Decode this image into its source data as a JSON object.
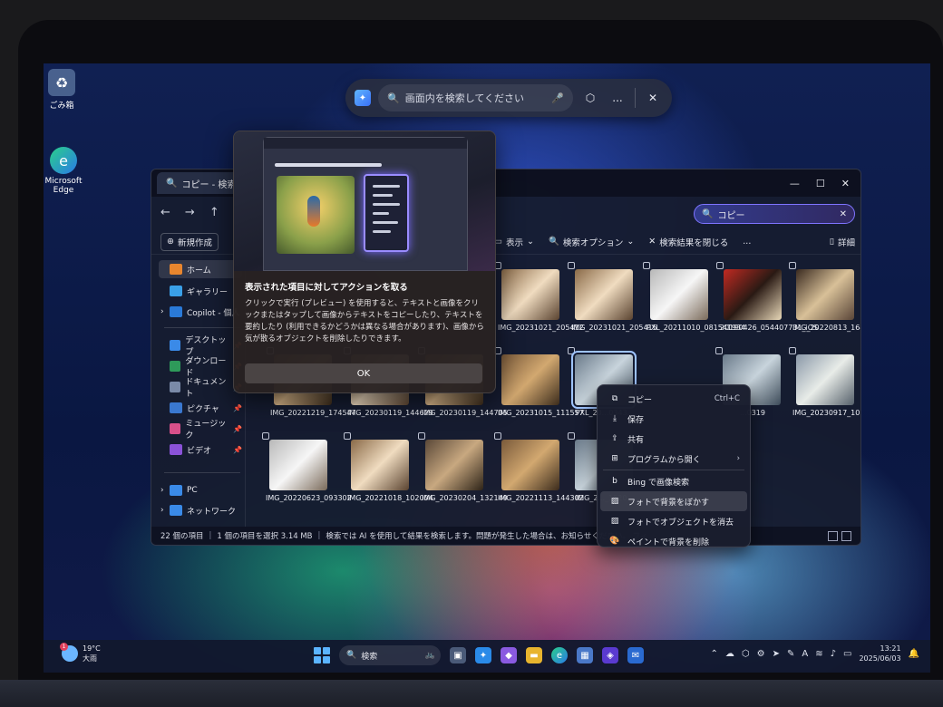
{
  "desktop": {
    "icons": [
      {
        "label": "ごみ箱",
        "icon": "recycle-bin-icon"
      },
      {
        "label": "Microsoft Edge",
        "icon": "edge-icon"
      }
    ]
  },
  "click_to_do": {
    "search_placeholder": "画面内を検索してください",
    "more_label": "...",
    "close_label": "✕"
  },
  "popup": {
    "title": "表示された項目に対してアクションを取る",
    "body": "クリックで実行 (プレビュー) を使用すると、テキストと画像をクリックまたはタップして画像からテキストをコピーしたり、テキストを要約したり (利用できるかどうかは異なる場合があります)、画像から気が散るオブジェクトを削除したりできます。",
    "ok_label": "OK"
  },
  "explorer": {
    "tab_title": "コピー - 検索場所",
    "search_value": "コピー",
    "toolbar": {
      "new_label": "新規作成",
      "view_label": "表示",
      "search_options_label": "検索オプション",
      "close_results_label": "検索結果を閉じる",
      "more_label": "...",
      "details_label": "詳細"
    },
    "sidebar": {
      "top": [
        {
          "label": "ホーム",
          "icon": "home-icon",
          "color": "#e8862e"
        },
        {
          "label": "ギャラリー",
          "icon": "gallery-icon",
          "color": "#3aa0e8"
        },
        {
          "label": "Copilot - 個人",
          "icon": "onedrive-icon",
          "color": "#2a7ad8"
        }
      ],
      "pinned": [
        {
          "label": "デスクトップ",
          "icon": "desktop-icon",
          "color": "#3a8ae8"
        },
        {
          "label": "ダウンロード",
          "icon": "download-icon",
          "color": "#2e9a5a"
        },
        {
          "label": "ドキュメント",
          "icon": "documents-icon",
          "color": "#7a8aa8"
        },
        {
          "label": "ピクチャ",
          "icon": "pictures-icon",
          "color": "#3a78d0"
        },
        {
          "label": "ミュージック",
          "icon": "music-icon",
          "color": "#d8508a"
        },
        {
          "label": "ビデオ",
          "icon": "video-icon",
          "color": "#8a52d8"
        }
      ],
      "bottom": [
        {
          "label": "PC",
          "icon": "pc-icon",
          "color": "#3a8ae8"
        },
        {
          "label": "ネットワーク",
          "icon": "network-icon",
          "color": "#3a8ae8"
        }
      ]
    },
    "thumbnails": [
      {
        "name": "IMG_20231021_205412",
        "tone": "c2"
      },
      {
        "name": "IMG_20231021_205415",
        "tone": "c2"
      },
      {
        "name": "PXL_20211010_081541934",
        "tone": "c3"
      },
      {
        "name": "20190426_054407731_iOS",
        "tone": "c4"
      },
      {
        "name": "IMG_20220813_164558",
        "tone": "c5"
      },
      {
        "name": "IMG_20221219_174547",
        "tone": "c1"
      },
      {
        "name": "IMG_20230119_144629",
        "tone": "c2"
      },
      {
        "name": "IMG_20230119_144705",
        "tone": "c1"
      },
      {
        "name": "IMG_20231015_111557",
        "tone": "c9"
      },
      {
        "name": "PXL_20...0343...",
        "tone": "c6"
      },
      {
        "name": "...0319",
        "tone": "c6"
      },
      {
        "name": "IMG_20230917_105231",
        "tone": "c8"
      },
      {
        "name": "IMG_20220623_093302",
        "tone": "c3"
      },
      {
        "name": "IMG_20221018_102004",
        "tone": "c2"
      },
      {
        "name": "IMG_20230204_132149",
        "tone": "c7"
      },
      {
        "name": "IMG_20221113_144302",
        "tone": "c9"
      },
      {
        "name": "IMG_2..._1520...",
        "tone": "c6"
      }
    ],
    "status": {
      "count": "22 個の項目",
      "selection": "1 個の項目を選択  3.14 MB",
      "message": "検索では AI を使用して結果を検索します。問題が発生した場合は、お知らせください。 フィ"
    }
  },
  "context_menu": {
    "items": [
      {
        "label": "コピー",
        "icon": "copy-icon",
        "shortcut": "Ctrl+C"
      },
      {
        "label": "保存",
        "icon": "save-icon"
      },
      {
        "label": "共有",
        "icon": "share-icon"
      },
      {
        "label": "プログラムから開く",
        "icon": "open-with-icon",
        "arrow": "›"
      },
      {
        "label": "Bing で画像検索",
        "icon": "bing-icon"
      },
      {
        "label": "フォトで背景をぼかす",
        "icon": "photos-icon"
      },
      {
        "label": "フォトでオブジェクトを消去",
        "icon": "photos-icon"
      },
      {
        "label": "ペイントで背景を削除",
        "icon": "paint-icon"
      }
    ]
  },
  "taskbar": {
    "weather_temp": "19°C",
    "weather_desc": "大雨",
    "weather_badge": "1",
    "search_label": "検索",
    "time": "13:21",
    "date": "2025/06/03"
  }
}
